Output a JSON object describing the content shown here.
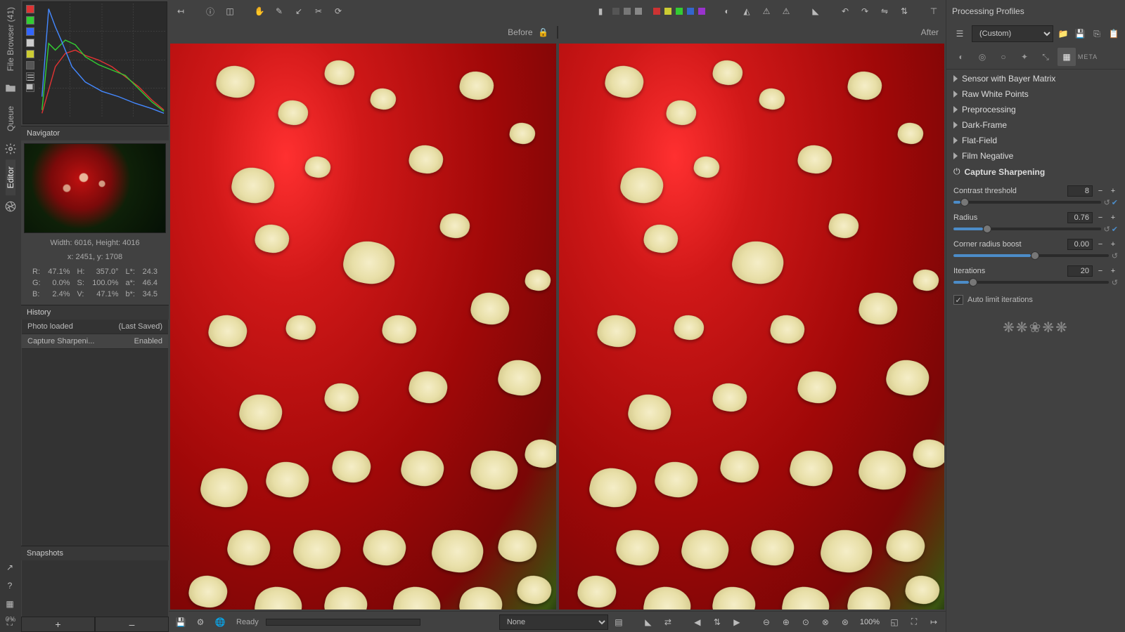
{
  "rail": {
    "file_browser": "File Browser (41)",
    "queue": "Queue",
    "editor": "Editor",
    "progress": "0%"
  },
  "left": {
    "navigator_title": "Navigator",
    "dims": "Width: 6016, Height: 4016",
    "coords": "x: 2451, y: 1708",
    "R_label": "R:",
    "R_val": "47.1%",
    "H_label": "H:",
    "H_val": "357.0°",
    "Lstar_label": "L*:",
    "Lstar_val": "24.3",
    "G_label": "G:",
    "G_val": "0.0%",
    "S_label": "S:",
    "S_val": "100.0%",
    "astar_label": "a*:",
    "astar_val": "46.4",
    "B_label": "B:",
    "B_val": "2.4%",
    "V_label": "V:",
    "V_val": "47.1%",
    "bstar_label": "b*:",
    "bstar_val": "34.5",
    "history_title": "History",
    "history": [
      {
        "name": "Photo loaded",
        "value": "(Last Saved)"
      },
      {
        "name": "Capture Sharpeni...",
        "value": "Enabled"
      }
    ],
    "snapshots_title": "Snapshots",
    "snap_plus": "+",
    "snap_minus": "–"
  },
  "center": {
    "before": "Before",
    "after": "After",
    "status": "Ready",
    "bg_dropdown": "None",
    "zoom_label": "100%"
  },
  "right": {
    "profiles_label": "Processing Profiles",
    "profile_selected": "(Custom)",
    "sections": [
      "Sensor with Bayer Matrix",
      "Raw White Points",
      "Preprocessing",
      "Dark-Frame",
      "Flat-Field",
      "Film Negative"
    ],
    "capture_sharpening": "Capture Sharpening",
    "params": {
      "contrast_threshold": {
        "label": "Contrast threshold",
        "value": "8",
        "fill": 5
      },
      "radius": {
        "label": "Radius",
        "value": "0.76",
        "fill": 20
      },
      "corner_boost": {
        "label": "Corner radius boost",
        "value": "0.00",
        "fill": 50
      },
      "iterations": {
        "label": "Iterations",
        "value": "20",
        "fill": 10
      }
    },
    "auto_limit": "Auto limit iterations"
  }
}
